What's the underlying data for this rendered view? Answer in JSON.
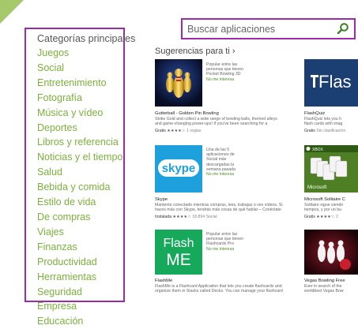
{
  "search": {
    "placeholder": "Buscar aplicaciones"
  },
  "sidebar": {
    "heading": "Categorías principales",
    "items": [
      "Juegos",
      "Social",
      "Entretenimiento",
      "Fotografía",
      "Música y vídeo",
      "Deportes",
      "Libros y referencia",
      "Noticias y el tiempo",
      "Salud",
      "Bebida y comida",
      "Estilo de vida",
      "De compras",
      "Viajes",
      "Finanzas",
      "Productividad",
      "Herramientas",
      "Seguridad",
      "Empresa",
      "Educación"
    ]
  },
  "suggestions": {
    "heading": "Sugerencias para ti",
    "arrow": "›",
    "apps": [
      {
        "title": "Gutterball - Golden Pin Bowling",
        "body1": "Strike Gold and collect a wide range of bowling balls, themed alleys",
        "body2": "and game-changing power-ups! If you've been searching for a",
        "price": "Gratis",
        "stars": "★★★★☆",
        "count": "1 reglas",
        "reason": [
          "Popular entre las",
          "personas que tienen",
          "Pocket Bowling 3D"
        ],
        "tag": "No me interesa"
      },
      {
        "title": "FlashQuiz",
        "body1": "FlashQuiz lets you h",
        "body2": "flash cards with imag",
        "price": "Gratis",
        "count": "Sin clasificación",
        "tile_text": "Flas"
      },
      {
        "title": "Skype",
        "body1": "Mantente conectado mientras compras, lees, trabajas o ves vídeos. Si",
        "body2": "haces más con Skype, tendrás más cosas de qué hablar – Conéctate",
        "price": "Instalada",
        "stars": "★★★★☆",
        "count": "18.894",
        "category": "Social",
        "logo": "skype",
        "reason": [
          "Una de las 5",
          "aplicaciones de",
          "Social más",
          "descargadas la",
          "semana pasada"
        ],
        "tag": "No me interesa"
      },
      {
        "title": "Microsoft Solitaire C",
        "body1": "Solitaire sigue siendo",
        "body2": "tiempos, y por un bu",
        "price": "Gratis",
        "stars": "★★★★☆",
        "count": "2",
        "badge": "XBOX"
      },
      {
        "title": "FlashMe",
        "body1": "FlashMe is a Flashcard Application that lets you create flashcards and",
        "body2": "organize them in Stacks called Decks. You can manage your flashcard",
        "tile_line1": "Flash",
        "tile_line2": "ME",
        "reason": [
          "Popular entre las",
          "personas que tienen",
          "Flashcards Pro"
        ],
        "tag": "No me interesa"
      },
      {
        "title": "Vegas Bowling Free",
        "body1": "Ever in search of the",
        "body2": "worldbest Vegas Bow"
      }
    ]
  }
}
